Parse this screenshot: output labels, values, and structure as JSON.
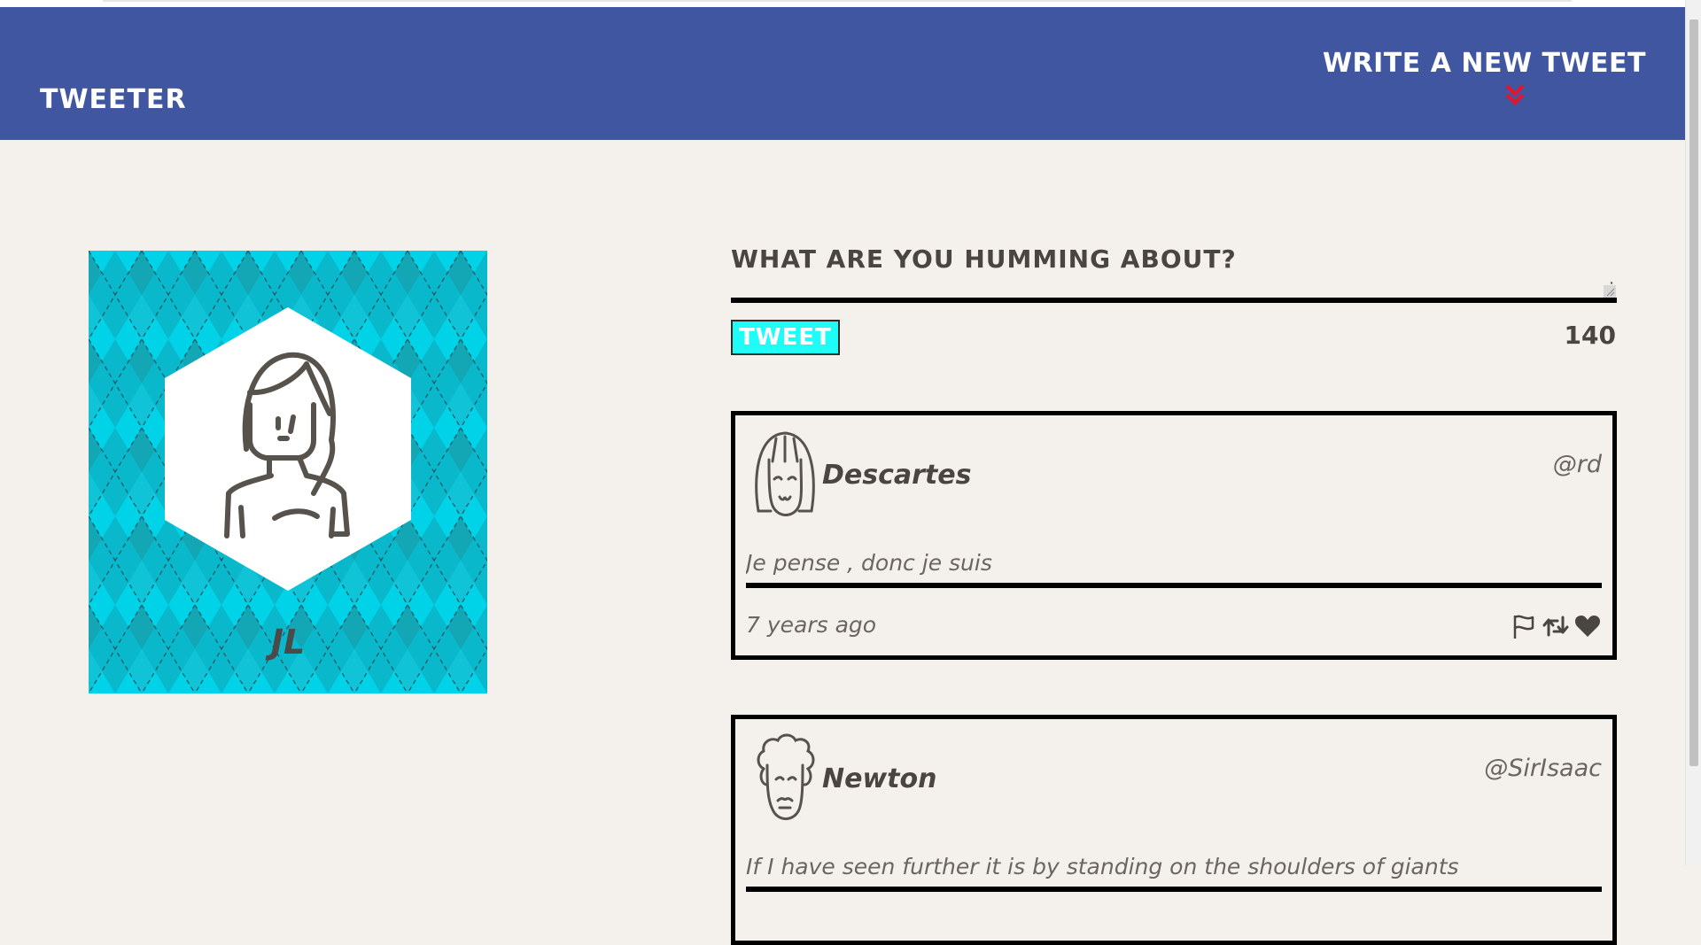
{
  "nav": {
    "brand": "Tweeter",
    "write_link": "Write a new tweet",
    "chevron_icon": "double-chevron-down-icon",
    "chevron_color": "#e8132b",
    "background": "#4156a1"
  },
  "profile": {
    "name": "JL",
    "pattern_color": "#00d3e8",
    "avatar_icon": "girl-avatar-icon"
  },
  "composer": {
    "label": "What are you humming about?",
    "placeholder": "",
    "button_label": "Tweet",
    "char_count": "140"
  },
  "tweets": [
    {
      "author": "Descartes",
      "handle": "@rd",
      "content": "Je pense , donc je suis",
      "time": "7 years ago",
      "avatar_icon": "bob-hair-face-icon",
      "actions": [
        "flag-icon",
        "retweet-icon",
        "heart-icon"
      ]
    },
    {
      "author": "Newton",
      "handle": "@SirIsaac",
      "content": "If I have seen further it is by standing on the shoulders of giants",
      "time": "",
      "avatar_icon": "curly-hair-face-icon",
      "actions": [
        "flag-icon",
        "retweet-icon",
        "heart-icon"
      ]
    }
  ]
}
